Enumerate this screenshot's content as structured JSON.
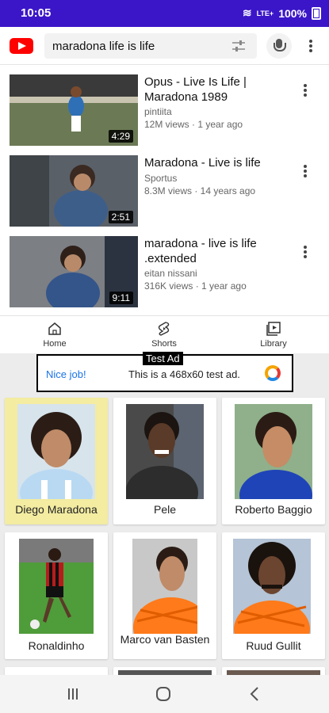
{
  "status": {
    "time": "10:05",
    "signal": "LTE+",
    "battery": "100%"
  },
  "search": {
    "query": "maradona life is life"
  },
  "videos": [
    {
      "title": "Opus - Live Is Life | Maradona 1989",
      "channel": "pintiita",
      "meta": "12M views · 1 year ago",
      "duration": "4:29"
    },
    {
      "title": "Maradona - Live is life",
      "channel": "Sportus",
      "meta": "8.3M views · 14 years ago",
      "duration": "2:51"
    },
    {
      "title": "maradona - live is life .extended",
      "channel": "eitan nissani",
      "meta": "316K views · 1 year ago",
      "duration": "9:11"
    }
  ],
  "nav": {
    "home": "Home",
    "shorts": "Shorts",
    "library": "Library"
  },
  "ad": {
    "label": "Test Ad",
    "nice": "Nice job!",
    "text": "This is a 468x60 test ad."
  },
  "players": [
    {
      "name": "Diego Maradona",
      "selected": true,
      "kit": "#b9d9f3",
      "bg": "#d7e4ec"
    },
    {
      "name": "Pele",
      "selected": false,
      "kit": "#2d2d2d",
      "bg": "#4a4a4a"
    },
    {
      "name": "Roberto Baggio",
      "selected": false,
      "kit": "#1f44b8",
      "bg": "#8fb08a"
    },
    {
      "name": "Ronaldinho",
      "selected": false,
      "kit": "#b71c1c",
      "bg": "#4f9c3a"
    },
    {
      "name": "Marco van Basten",
      "selected": false,
      "kit": "#ff7a1a",
      "bg": "#c8c8c8"
    },
    {
      "name": "Ruud Gullit",
      "selected": false,
      "kit": "#ff7a1a",
      "bg": "#b5c4d6"
    }
  ]
}
